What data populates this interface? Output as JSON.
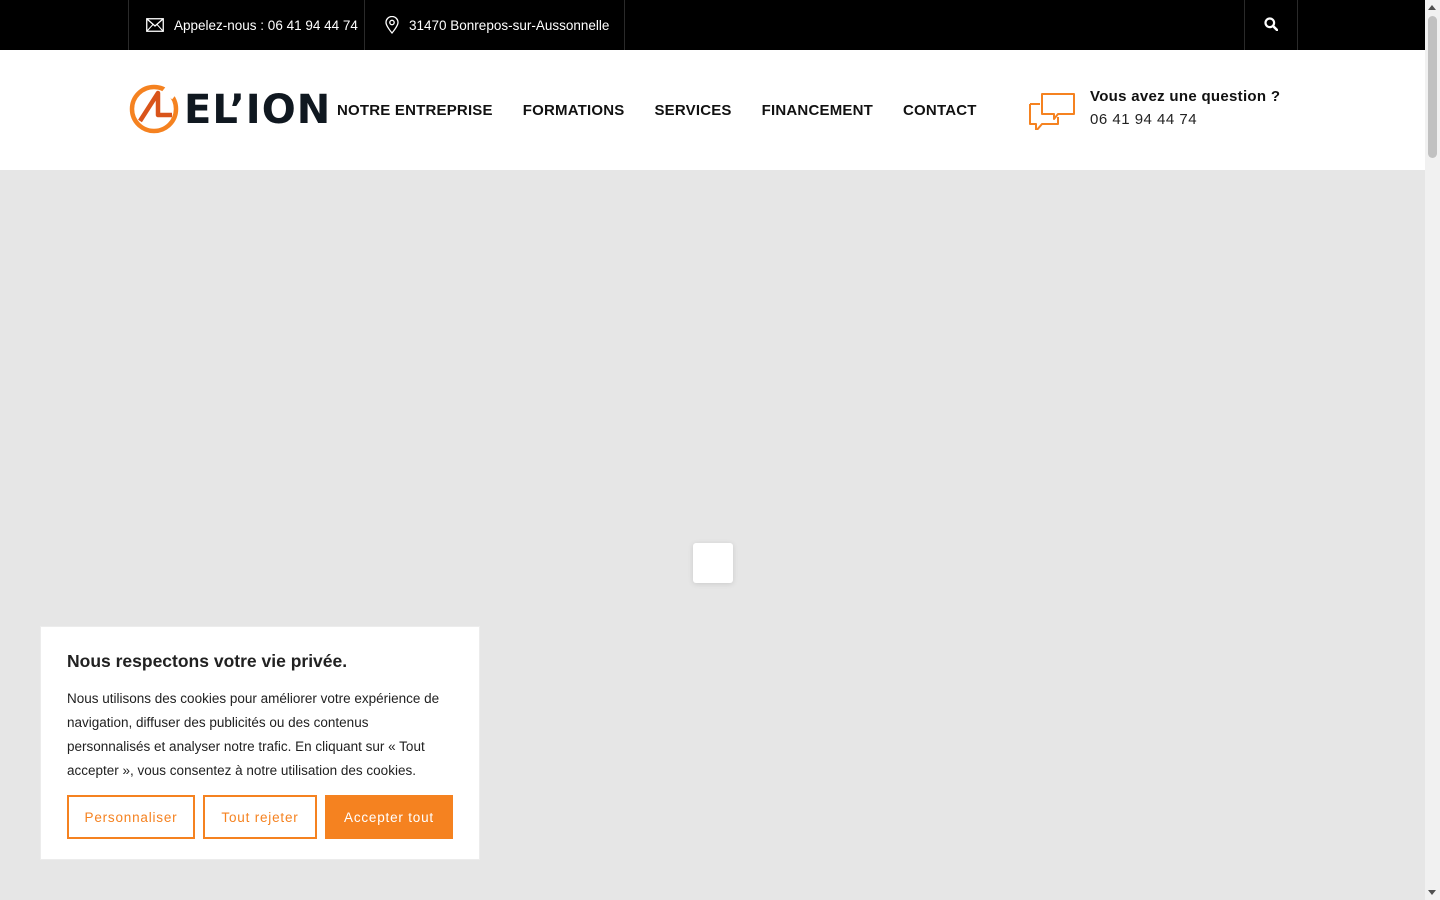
{
  "topbar": {
    "phone_text": "Appelez-nous : 06 41 94 44 74",
    "address_text": "31470 Bonrepos-sur-Aussonnelle",
    "icons": [
      "envelope-icon",
      "map-pin-icon",
      "search-icon"
    ]
  },
  "header": {
    "logo_text": "EL’ION",
    "nav": [
      {
        "label": "NOTRE ENTREPRISE"
      },
      {
        "label": "FORMATIONS"
      },
      {
        "label": "SERVICES"
      },
      {
        "label": "FINANCEMENT"
      },
      {
        "label": "CONTACT"
      }
    ],
    "question_title": "Vous avez une question ?",
    "question_phone": "06 41 94 44 74"
  },
  "cookie_banner": {
    "title": "Nous respectons votre vie privée.",
    "body": "Nous utilisons des cookies pour améliorer votre expérience de navigation, diffuser des publicités ou des contenus personnalisés et analyser notre trafic. En cliquant sur « Tout accepter », vous consentez à notre utilisation des cookies.",
    "customize_label": "Personnaliser",
    "reject_label": "Tout rejeter",
    "accept_label": "Accepter tout"
  },
  "colors": {
    "accent": "#f58220",
    "topbar_bg": "#000000",
    "content_bg": "#e6e6e6",
    "text_dark": "#111111"
  }
}
